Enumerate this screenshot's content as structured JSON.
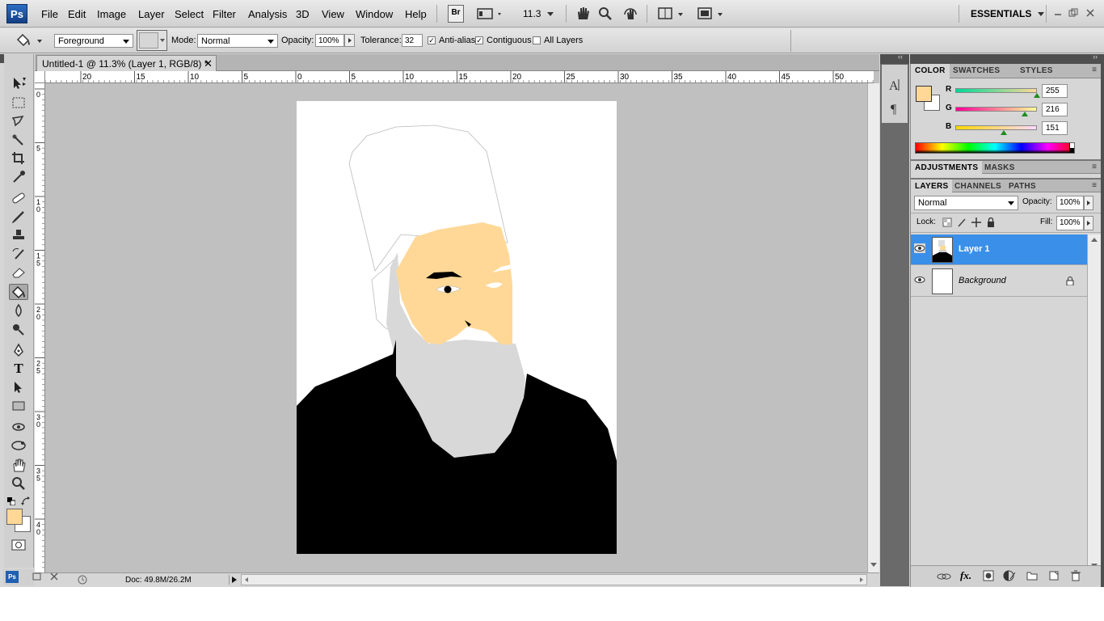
{
  "app": {
    "logo": "Ps"
  },
  "menu": [
    "File",
    "Edit",
    "Image",
    "Layer",
    "Select",
    "Filter",
    "Analysis",
    "3D",
    "View",
    "Window",
    "Help"
  ],
  "menubar": {
    "bridge": "Br",
    "zoom": "11.3",
    "workspace": "ESSENTIALS"
  },
  "options": {
    "fill_source": "Foreground",
    "mode_label": "Mode:",
    "mode_value": "Normal",
    "opacity_label": "Opacity:",
    "opacity_value": "100%",
    "tolerance_label": "Tolerance:",
    "tolerance_value": "32",
    "antialias_label": "Anti-alias",
    "contiguous_label": "Contiguous",
    "all_layers_label": "All Layers"
  },
  "document": {
    "tab_title": "Untitled-1 @ 11.3% (Layer 1, RGB/8) *",
    "doc_info": "Doc: 49.8M/26.2M",
    "hruler_labels": [
      "20",
      "15",
      "10",
      "5",
      "0",
      "5",
      "10",
      "15",
      "20",
      "25",
      "30",
      "35",
      "40",
      "45",
      "50"
    ],
    "vruler_labels": [
      "0",
      "5",
      "1 0",
      "1 5",
      "2 0",
      "2 5",
      "3 0",
      "3 5",
      "4 0"
    ]
  },
  "color_panel": {
    "tabs": [
      "COLOR",
      "SWATCHES",
      "STYLES"
    ],
    "channels": [
      {
        "name": "R",
        "value": "255",
        "fraction": 1.0
      },
      {
        "name": "G",
        "value": "216",
        "fraction": 0.847
      },
      {
        "name": "B",
        "value": "151",
        "fraction": 0.592
      }
    ],
    "foreground": "#ffd897",
    "background": "#ffffff"
  },
  "adjustments_panel": {
    "tabs": [
      "ADJUSTMENTS",
      "MASKS"
    ]
  },
  "layers_panel": {
    "tabs": [
      "LAYERS",
      "CHANNELS",
      "PATHS"
    ],
    "blend_mode": "Normal",
    "opacity_label": "Opacity:",
    "opacity_value": "100%",
    "lock_label": "Lock:",
    "fill_label": "Fill:",
    "fill_value": "100%",
    "layers": [
      {
        "name": "Layer 1",
        "selected": true
      },
      {
        "name": "Background",
        "selected": false,
        "locked": true
      }
    ]
  },
  "colors": {
    "accent": "#3a8fe8",
    "skin": "#ffd897",
    "beard": "#d8d8d8",
    "robe": "#000000"
  }
}
